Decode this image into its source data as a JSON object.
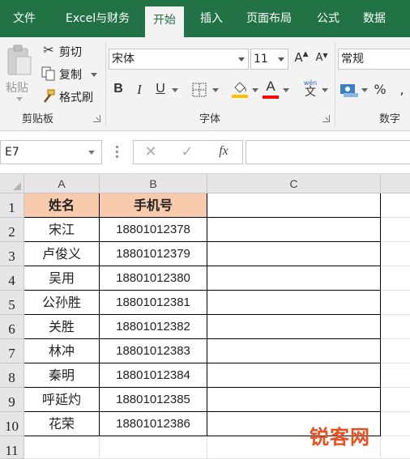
{
  "ribbon_tabs": [
    "文件",
    "Excel与财务",
    "开始",
    "插入",
    "页面布局",
    "公式",
    "数据"
  ],
  "active_tab": "开始",
  "clipboard": {
    "paste_label": "粘贴",
    "cut_label": "剪切",
    "copy_label": "复制",
    "format_painter_label": "格式刷",
    "group_label": "剪贴板"
  },
  "font": {
    "font_name": "宋体",
    "font_size": "11",
    "bold": "B",
    "italic": "I",
    "underline": "U",
    "font_color_glyph": "A",
    "phonetic_glyph": "wén",
    "phonetic_char": "文",
    "group_label": "字体"
  },
  "number": {
    "format": "常规",
    "percent": "%",
    "group_label": "数字"
  },
  "formula_bar": {
    "cell_ref": "E7",
    "fx_label": "fx",
    "formula": ""
  },
  "columns": [
    "A",
    "B",
    "C"
  ],
  "rows": [
    "1",
    "2",
    "3",
    "4",
    "5",
    "6",
    "7",
    "8",
    "9",
    "10",
    "11"
  ],
  "table": {
    "headers": [
      "姓名",
      "手机号"
    ],
    "records": [
      [
        "宋江",
        "18801012378"
      ],
      [
        "卢俊义",
        "18801012379"
      ],
      [
        "吴用",
        "18801012380"
      ],
      [
        "公孙胜",
        "18801012381"
      ],
      [
        "关胜",
        "18801012382"
      ],
      [
        "林冲",
        "18801012383"
      ],
      [
        "秦明",
        "18801012384"
      ],
      [
        "呼延灼",
        "18801012385"
      ],
      [
        "花荣",
        "18801012386"
      ]
    ]
  },
  "watermark": "锐客网",
  "colors": {
    "ribbon_green": "#217346",
    "header_fill": "#f8cbad",
    "font_color_red": "#ff0000",
    "fill_color_yellow": "#ffc000"
  }
}
